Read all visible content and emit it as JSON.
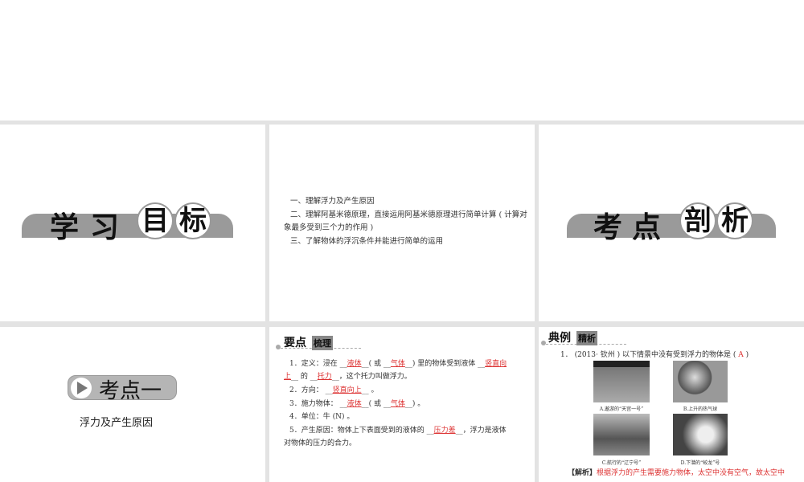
{
  "slide1": {
    "title_chars": [
      "学",
      "习",
      "目",
      "标"
    ]
  },
  "slide2": {
    "goals": [
      "一、理解浮力及产生原因",
      "二、理解阿基米德原理，直接运用阿基米德原理进行简单计算 ( 计算对",
      "象最多受到三个力的作用 )",
      "三、了解物体的浮沉条件并能进行简单的运用"
    ]
  },
  "slide3": {
    "title_chars": [
      "考",
      "点",
      "剖",
      "析"
    ]
  },
  "slide4": {
    "badge": "考点一",
    "subtitle": "浮力及产生原因"
  },
  "slide5": {
    "header": "要点",
    "header_box": "梳理",
    "l1a": "1．定义：浸在 __",
    "a1": "液体",
    "l1b": "__( 或 __",
    "a2": "气体",
    "l1c": "__) 里的物体受到液体 __",
    "a3": "竖直向",
    "a3b": "上",
    "l1d": "__ 的 __",
    "a4": "托力",
    "l1e": "__，这个托力叫做浮力。",
    "l2a": "2．方向： __",
    "a5": "竖直向上",
    "l2b": "__ 。",
    "l3a": "3．施力物体： __",
    "a6": "液体",
    "l3b": "__( 或 __",
    "a7": "气体",
    "l3c": "__) 。",
    "l4": "4．单位：牛 (N) 。",
    "l5a": "5．产生原因：物体上下表面受到的液体的 __",
    "a8": "压力差",
    "l5b": "__，浮力是液体",
    "l5c": "对物体的压力的合力。"
  },
  "slide6": {
    "header": "典例",
    "header_box": "精析",
    "q_pre": "1． (2013· 钦州 ) 以下情景中没有受到浮力的物体是 (",
    "q_ans": "A",
    "q_post": ")",
    "captions": [
      "A.遨游的“天宫一号”",
      "B.上升的热气球",
      "C.航行的“辽宁号”",
      "D.下潜的“蛟龙”号"
    ],
    "analysis_label": "【解析】",
    "analysis": "根据浮力的产生需要施力物体，太空中没有空气，故太空中"
  }
}
